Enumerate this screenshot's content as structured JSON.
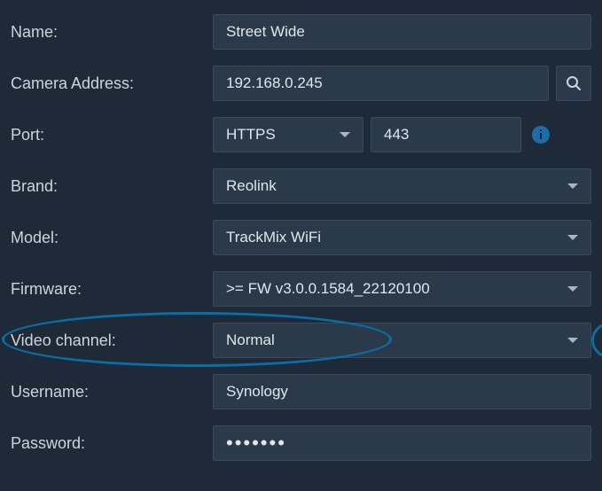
{
  "fields": {
    "name": {
      "label": "Name:",
      "value": "Street Wide"
    },
    "address": {
      "label": "Camera Address:",
      "value": "192.168.0.245"
    },
    "port": {
      "label": "Port:",
      "protocol": "HTTPS",
      "number": "443"
    },
    "brand": {
      "label": "Brand:",
      "value": "Reolink"
    },
    "model": {
      "label": "Model:",
      "value": "TrackMix WiFi"
    },
    "firmware": {
      "label": "Firmware:",
      "value": ">= FW v3.0.0.1584_22120100"
    },
    "videoChannel": {
      "label": "Video channel:",
      "value": "Normal"
    },
    "username": {
      "label": "Username:",
      "value": "Synology"
    },
    "password": {
      "label": "Password:",
      "value": "•••••••"
    }
  },
  "colors": {
    "highlight": "#0a6ea5"
  }
}
